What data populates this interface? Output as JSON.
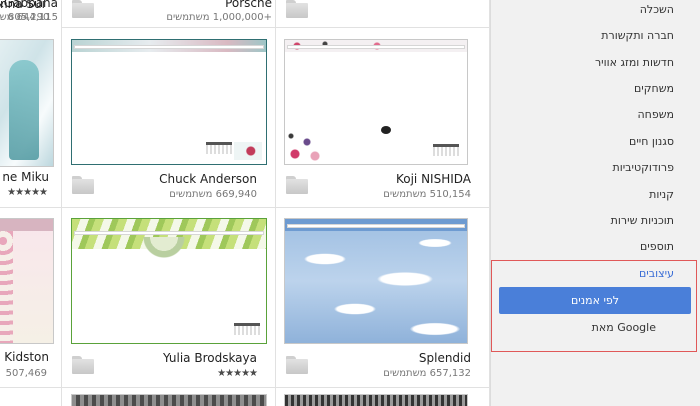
{
  "sidebar": {
    "items": [
      "השכלה",
      "חברה ותקשורת",
      "חדשות ומזג אוויר",
      "משחקים",
      "משפחה",
      "סגנון חיים",
      "פרודוקטיביות",
      "קניות",
      "תוכניות שירות",
      "תוספים"
    ],
    "active": "עיצובים",
    "sub_active": "לפי אמנים",
    "sub_other": "מאת Google"
  },
  "themes": [
    {
      "title": "Dolce&Gabbana",
      "users": "644,115 משתמשים"
    },
    {
      "title": "Porsche",
      "users": "+1,000,000 משתמשים"
    },
    {
      "title": "Chuck Anderson",
      "users": "669,940 משתמשים"
    },
    {
      "title": "Koji NISHIDA",
      "users": "510,154 משתמשים"
    },
    {
      "title": "Yulia Brodskaya",
      "stars": "★★★★★"
    },
    {
      "title": "Splendid",
      "users": "657,132 משתמשים"
    }
  ],
  "left_partial": [
    {
      "title": "nna Sui",
      "users": "805,290"
    },
    {
      "title": "ne Miku",
      "stars": "★★★★★"
    },
    {
      "title": "Kidston",
      "users": "507,469"
    }
  ],
  "colors": {
    "accent": "#4a7fd9",
    "highlight_border": "#e05858",
    "active_link": "#3b6ed6"
  }
}
